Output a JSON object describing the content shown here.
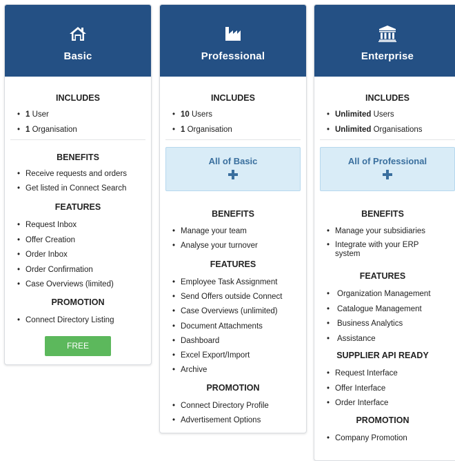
{
  "plans": {
    "basic": {
      "title": "Basic",
      "icon": "home-icon",
      "includes_title": "INCLUDES",
      "includes": [
        {
          "bold": "1",
          "text": " User"
        },
        {
          "bold": "1",
          "text": " Organisation"
        }
      ],
      "benefits_title": "BENEFITS",
      "benefits": [
        "Receive requests and orders",
        "Get listed in Connect Search"
      ],
      "features_title": "FEATURES",
      "features": [
        "Request Inbox",
        "Offer Creation",
        "Order Inbox",
        "Order Confirmation",
        "Case Overviews (limited)"
      ],
      "promotion_title": "PROMOTION",
      "promotion": [
        "Connect Directory Listing"
      ],
      "button_label": "FREE"
    },
    "professional": {
      "title": "Professional",
      "icon": "factory-icon",
      "includes_title": "INCLUDES",
      "includes": [
        {
          "bold": "10",
          "text": " Users"
        },
        {
          "bold": "1",
          "text": " Organisation"
        }
      ],
      "allof_label": "All of Basic",
      "benefits_title": "BENEFITS",
      "benefits": [
        "Manage your team",
        "Analyse your turnover"
      ],
      "features_title": "FEATURES",
      "features": [
        "Employee Task Assignment",
        "Send Offers outside Connect",
        "Case Overviews (unlimited)",
        "Document Attachments",
        "Dashboard",
        "Excel Export/Import",
        "Archive"
      ],
      "promotion_title": "PROMOTION",
      "promotion": [
        "Connect Directory Profile",
        "Advertisement Options"
      ]
    },
    "enterprise": {
      "title": "Enterprise",
      "icon": "bank-icon",
      "includes_title": "INCLUDES",
      "includes": [
        {
          "bold": "Unlimited",
          "text": " Users"
        },
        {
          "bold": "Unlimited",
          "text": " Organisations"
        }
      ],
      "allof_label": "All of Professional",
      "benefits_title": "BENEFITS",
      "benefits": [
        "Manage your subsidiaries",
        "Integrate with your ERP system"
      ],
      "features_title": "FEATURES",
      "features": [
        "Organization Management",
        "Catalogue Management",
        "Business Analytics",
        "Assistance"
      ],
      "api_title": "SUPPLIER API READY",
      "api": [
        "Request Interface",
        "Offer Interface",
        "Order Interface"
      ],
      "promotion_title": "PROMOTION",
      "promotion": [
        "Company Promotion"
      ]
    }
  },
  "colors": {
    "header": "#245084",
    "allof_bg": "#d9ecf7",
    "allof_text": "#3a6f9e",
    "free_button": "#5cb85c"
  }
}
